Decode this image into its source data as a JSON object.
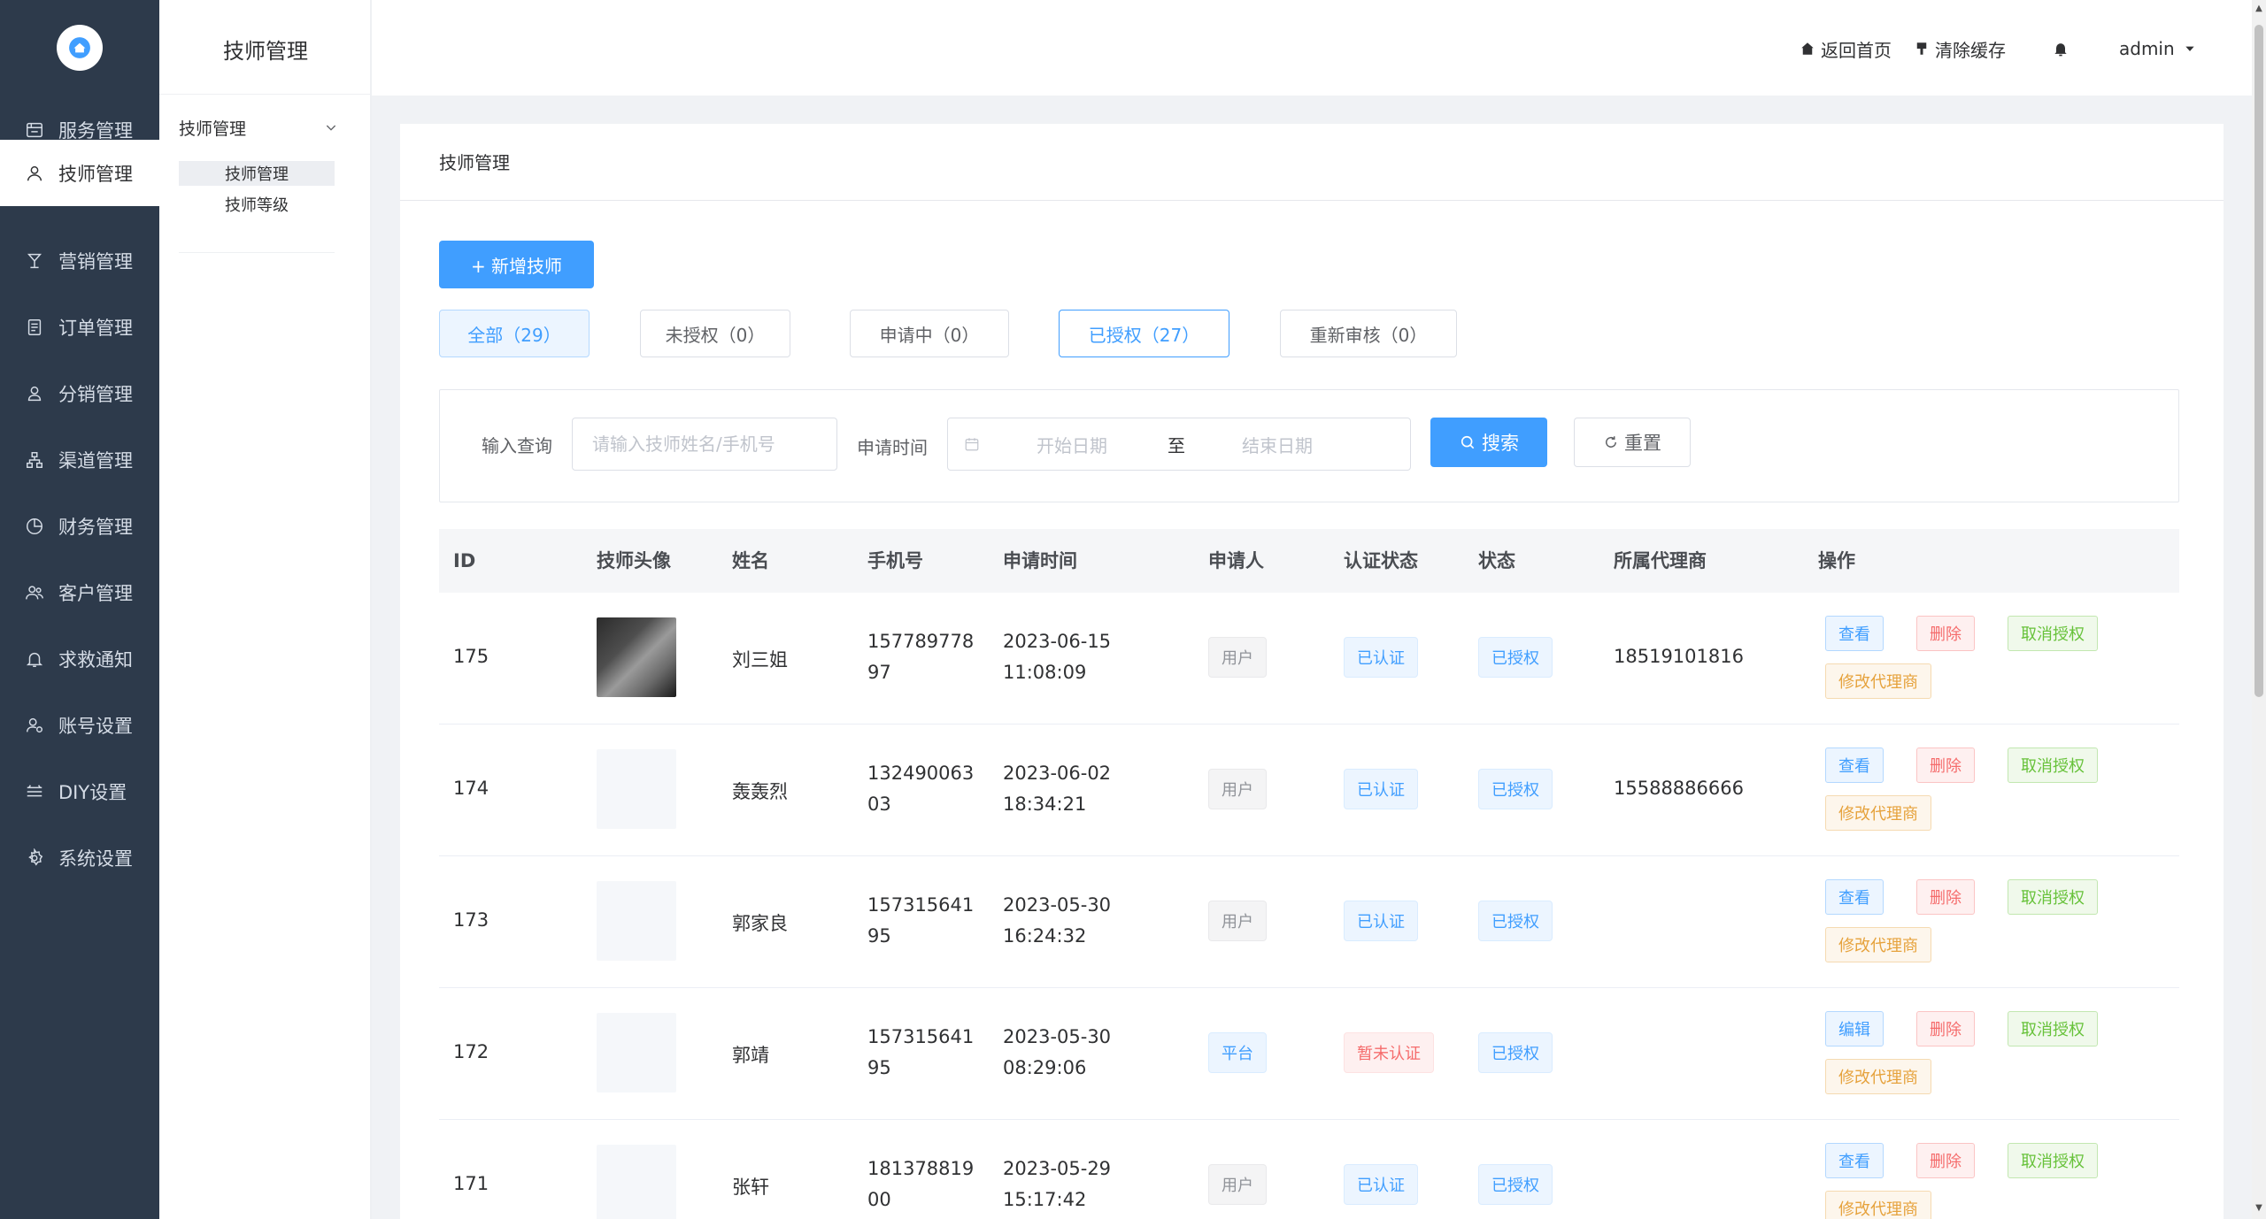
{
  "sidebar": {
    "items": [
      {
        "label": "服务管理",
        "icon": "service-icon"
      },
      {
        "label": "技师管理",
        "icon": "user-icon"
      },
      {
        "label": "营销管理",
        "icon": "marketing-icon"
      },
      {
        "label": "订单管理",
        "icon": "order-icon"
      },
      {
        "label": "分销管理",
        "icon": "distribution-icon"
      },
      {
        "label": "渠道管理",
        "icon": "channel-icon"
      },
      {
        "label": "财务管理",
        "icon": "finance-icon"
      },
      {
        "label": "客户管理",
        "icon": "customer-icon"
      },
      {
        "label": "求救通知",
        "icon": "bell-icon"
      },
      {
        "label": "账号设置",
        "icon": "account-icon"
      },
      {
        "label": "DIY设置",
        "icon": "diy-icon"
      },
      {
        "label": "系统设置",
        "icon": "settings-icon"
      }
    ],
    "active_index": 1
  },
  "subnav": {
    "title": "技师管理",
    "group_label": "技师管理",
    "items": [
      {
        "label": "技师管理",
        "active": true
      },
      {
        "label": "技师等级",
        "active": false
      }
    ]
  },
  "header": {
    "home": "返回首页",
    "clear_cache": "清除缓存",
    "user": "admin"
  },
  "page": {
    "title": "技师管理",
    "add_button": "+ 新增技师",
    "tabs": [
      {
        "label": "全部（29）"
      },
      {
        "label": "未授权（0）"
      },
      {
        "label": "申请中（0）"
      },
      {
        "label": "已授权（27）"
      },
      {
        "label": "重新审核（0）"
      }
    ]
  },
  "search": {
    "query_label": "输入查询",
    "query_placeholder": "请输入技师姓名/手机号",
    "time_label": "申请时间",
    "start_placeholder": "开始日期",
    "separator": "至",
    "end_placeholder": "结束日期",
    "search_button": "搜索",
    "reset_button": "重置"
  },
  "table": {
    "columns": [
      "ID",
      "技师头像",
      "姓名",
      "手机号",
      "申请时间",
      "申请人",
      "认证状态",
      "状态",
      "所属代理商",
      "操作"
    ],
    "rows": [
      {
        "id": "175",
        "name": "刘三姐",
        "phone1": "157789778",
        "phone2": "97",
        "date": "2023-06-15",
        "time": "11:08:09",
        "applicant": "用户",
        "cert": "已认证",
        "status": "已授权",
        "agent": "18519101816",
        "op_view": "查看",
        "op_del": "删除",
        "op_revoke": "取消授权",
        "op_agent": "修改代理商"
      },
      {
        "id": "174",
        "name": "轰轰烈",
        "phone1": "132490063",
        "phone2": "03",
        "date": "2023-06-02",
        "time": "18:34:21",
        "applicant": "用户",
        "cert": "已认证",
        "status": "已授权",
        "agent": "15588886666",
        "op_view": "查看",
        "op_del": "删除",
        "op_revoke": "取消授权",
        "op_agent": "修改代理商"
      },
      {
        "id": "173",
        "name": "郭家良",
        "phone1": "157315641",
        "phone2": "95",
        "date": "2023-05-30",
        "time": "16:24:32",
        "applicant": "用户",
        "cert": "已认证",
        "status": "已授权",
        "agent": "",
        "op_view": "查看",
        "op_del": "删除",
        "op_revoke": "取消授权",
        "op_agent": "修改代理商"
      },
      {
        "id": "172",
        "name": "郭靖",
        "phone1": "157315641",
        "phone2": "95",
        "date": "2023-05-30",
        "time": "08:29:06",
        "applicant": "平台",
        "cert": "暂未认证",
        "status": "已授权",
        "agent": "",
        "op_view": "编辑",
        "op_del": "删除",
        "op_revoke": "取消授权",
        "op_agent": "修改代理商"
      },
      {
        "id": "171",
        "name": "张轩",
        "phone1": "181378819",
        "phone2": "00",
        "date": "2023-05-29",
        "time": "15:17:42",
        "applicant": "用户",
        "cert": "已认证",
        "status": "已授权",
        "agent": "",
        "op_view": "查看",
        "op_del": "删除",
        "op_revoke": "取消授权",
        "op_agent": "修改代理商"
      }
    ]
  },
  "colors": {
    "sidebar_bg": "#2d3a4b",
    "primary": "#409eff",
    "danger": "#f56c6c",
    "success": "#67c23a",
    "warning": "#e6a23c"
  }
}
